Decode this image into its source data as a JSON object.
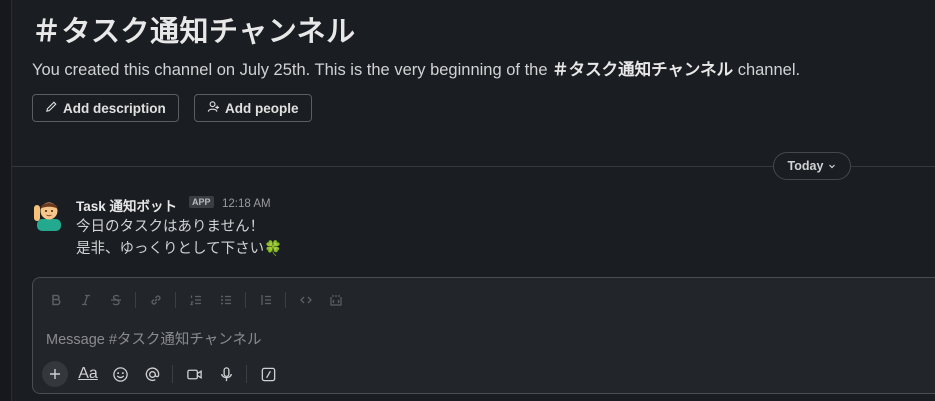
{
  "channel": {
    "title": "＃タスク通知チャンネル",
    "intro_prefix": "You created this channel on July 25th. This is the very beginning of the ",
    "intro_channel": "＃タスク通知チャンネル",
    "intro_suffix": " channel."
  },
  "actions": {
    "add_description": "Add description",
    "add_people": "Add people"
  },
  "divider": {
    "date_label": "Today"
  },
  "message": {
    "sender": "Task 通知ボット",
    "badge": "APP",
    "time": "12:18 AM",
    "lines": [
      "今日のタスクはありません！",
      "是非、ゆっくりとして下さい🍀"
    ]
  },
  "composer": {
    "placeholder": "Message #タスク通知チャンネル",
    "format_tools": [
      "bold-icon",
      "italic-icon",
      "strikethrough-icon",
      "link-icon",
      "ordered-list-icon",
      "bulleted-list-icon",
      "blockquote-icon",
      "code-icon",
      "code-block-icon"
    ],
    "text_format_label": "Aa"
  },
  "colors": {
    "background": "#1a1d21",
    "composer": "#222529",
    "text": "#d1d2d3"
  }
}
